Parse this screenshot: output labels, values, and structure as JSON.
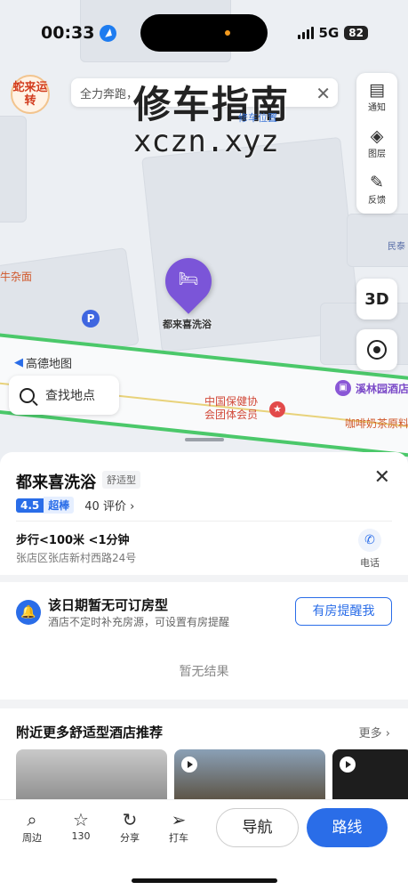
{
  "status": {
    "time": "00:33",
    "network": "5G",
    "battery": "82"
  },
  "banner": {
    "logo_text": "蛇来运转",
    "text": "全力奔跑，",
    "close": "✕"
  },
  "watermark": {
    "line1": "修车指南",
    "line2": "xczn.xyz",
    "under": "修车位置"
  },
  "tools": [
    {
      "label": "通知",
      "icon": "note-icon"
    },
    {
      "label": "图层",
      "icon": "layers-icon"
    },
    {
      "label": "反馈",
      "icon": "edit-icon"
    }
  ],
  "map": {
    "btn_3d": "3D",
    "pin_label": "都来喜洗浴",
    "label_left": "牛杂面",
    "label_right": "民泰",
    "brand": "高德地图",
    "search_placeholder": "查找地点",
    "poi_red_label": "中国保健协会团体会员",
    "poi_purple_label": "溪林园酒店",
    "poi_orange_label": "咖啡奶茶原料"
  },
  "hotel": {
    "name": "都来喜洗浴",
    "type": "舒适型",
    "score": "4.5",
    "score_tag": "超棒",
    "reviews": "40 评价 ›",
    "walk": "步行<100米 <1分钟",
    "address": "张店区张店新村西路24号",
    "phone_label": "电话"
  },
  "notice": {
    "title": "该日期暂无可订房型",
    "subtitle": "酒店不定时补充房源，可设置有房提醒",
    "remind_button": "有房提醒我",
    "no_result": "暂无结果"
  },
  "recommend": {
    "title": "附近更多舒适型酒店推荐",
    "more": "更多 ›"
  },
  "bottom": {
    "items": [
      {
        "label": "周边",
        "icon": "search-icon"
      },
      {
        "label": "130",
        "icon": "star-icon"
      },
      {
        "label": "分享",
        "icon": "share-icon"
      },
      {
        "label": "打车",
        "icon": "taxi-icon"
      }
    ],
    "nav": "导航",
    "route": "路线"
  },
  "colors": {
    "accent": "#2a6de8",
    "pin": "#7b55d8",
    "road_green": "#4bc86a"
  }
}
